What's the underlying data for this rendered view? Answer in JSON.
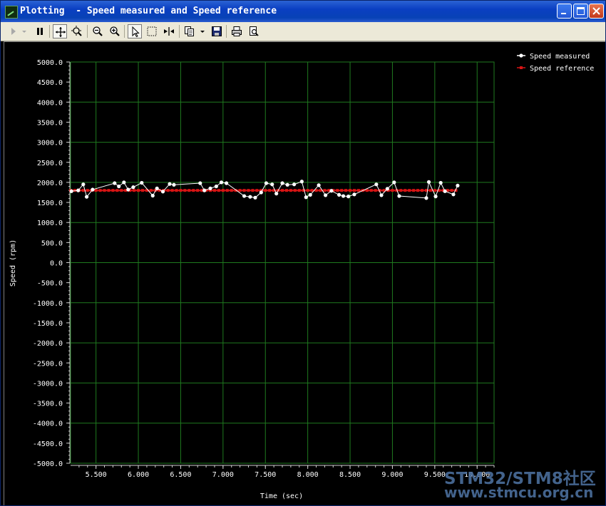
{
  "window": {
    "title": "Plotting  - Speed measured and Speed reference",
    "controls": [
      "minimize-icon",
      "maximize-icon",
      "close-icon"
    ]
  },
  "toolbar": {
    "tools": [
      "play-icon",
      "dropdown-icon",
      "pause-icon",
      "pan-icon",
      "zoom-fit-icon",
      "zoom-out-icon",
      "zoom-in-icon",
      "select-pointer-icon",
      "select-rect-icon",
      "split-cursor-icon",
      "copy-icon",
      "dropdown-icon",
      "save-icon",
      "print-icon",
      "print-preview-icon"
    ]
  },
  "watermark": {
    "line1": "STM32/STM8社区",
    "line2": "www.stmcu.org.cn"
  },
  "colors": {
    "background": "#000000",
    "grid": "#1f7a1f",
    "axis": "#cfcfcf",
    "measured": "#ffffff",
    "reference": "#d81414"
  },
  "chart_data": {
    "type": "line",
    "title": "",
    "xlabel": "Time (sec)",
    "ylabel": "Speed (rpm)",
    "xlim": [
      5.2,
      10.2
    ],
    "ylim": [
      -5000,
      5000
    ],
    "grid": true,
    "legend": "top-right",
    "xticks": [
      5.5,
      6.0,
      6.5,
      7.0,
      7.5,
      8.0,
      8.5,
      9.0,
      9.5,
      10.0
    ],
    "xtick_labels": [
      "5.500",
      "6.000",
      "6.500",
      "7.000",
      "7.500",
      "8.000",
      "8.500",
      "9.000",
      "9.500",
      "10.000"
    ],
    "yticks": [
      5000,
      4500,
      4000,
      3500,
      3000,
      2500,
      2000,
      1500,
      1000,
      500,
      0,
      -500,
      -1000,
      -1500,
      -2000,
      -2500,
      -3000,
      -3500,
      -4000,
      -4500,
      -5000
    ],
    "ytick_labels": [
      "5000.0",
      "4500.0",
      "4000.0",
      "3500.0",
      "3000.0",
      "2500.0",
      "2000.0",
      "1500.0",
      "1000.0",
      "500.0",
      "0.0",
      "-500.0",
      "-1000.0",
      "-1500.0",
      "-2000.0",
      "-2500.0",
      "-3000.0",
      "-3500.0",
      "-4000.0",
      "-4500.0",
      "-5000.0"
    ],
    "series": [
      {
        "name": "Speed measured",
        "color": "#ffffff",
        "marker": "circle",
        "x": [
          5.21,
          5.29,
          5.35,
          5.39,
          5.46,
          5.72,
          5.77,
          5.83,
          5.88,
          5.94,
          6.04,
          6.17,
          6.22,
          6.29,
          6.37,
          6.42,
          6.73,
          6.78,
          6.85,
          6.92,
          6.98,
          7.04,
          7.25,
          7.32,
          7.38,
          7.45,
          7.51,
          7.58,
          7.63,
          7.7,
          7.76,
          7.84,
          7.93,
          7.98,
          8.03,
          8.13,
          8.21,
          8.28,
          8.37,
          8.42,
          8.48,
          8.55,
          8.81,
          8.87,
          8.94,
          9.02,
          9.08,
          9.4,
          9.43,
          9.51,
          9.57,
          9.62,
          9.72,
          9.77
        ],
        "y": [
          1780,
          1800,
          1950,
          1640,
          1820,
          1980,
          1900,
          2000,
          1820,
          1880,
          1990,
          1670,
          1850,
          1770,
          1960,
          1940,
          1980,
          1800,
          1850,
          1900,
          2000,
          1980,
          1660,
          1640,
          1620,
          1750,
          1980,
          1950,
          1720,
          1980,
          1940,
          1950,
          2020,
          1630,
          1690,
          1930,
          1680,
          1790,
          1690,
          1660,
          1650,
          1700,
          1950,
          1680,
          1840,
          2000,
          1660,
          1610,
          2010,
          1650,
          1990,
          1780,
          1700,
          1920
        ]
      },
      {
        "name": "Speed reference",
        "color": "#d81414",
        "marker": "square",
        "x": [
          5.2,
          5.25,
          5.3,
          5.35,
          5.4,
          5.45,
          5.5,
          5.55,
          5.6,
          5.65,
          5.7,
          5.75,
          5.8,
          5.85,
          5.9,
          5.95,
          6.0,
          6.05,
          6.1,
          6.15,
          6.2,
          6.25,
          6.3,
          6.35,
          6.4,
          6.45,
          6.5,
          6.55,
          6.6,
          6.65,
          6.7,
          6.75,
          6.8,
          6.85,
          6.9,
          6.95,
          7.0,
          7.05,
          7.1,
          7.15,
          7.2,
          7.25,
          7.3,
          7.35,
          7.4,
          7.45,
          7.5,
          7.55,
          7.6,
          7.65,
          7.7,
          7.75,
          7.8,
          7.85,
          7.9,
          7.95,
          8.0,
          8.05,
          8.1,
          8.15,
          8.2,
          8.25,
          8.3,
          8.35,
          8.4,
          8.45,
          8.5,
          8.55,
          8.6,
          8.65,
          8.7,
          8.75,
          8.8,
          8.85,
          8.9,
          8.95,
          9.0,
          9.05,
          9.1,
          9.15,
          9.2,
          9.25,
          9.3,
          9.35,
          9.4,
          9.45,
          9.5,
          9.55,
          9.6,
          9.65,
          9.7,
          9.75
        ],
        "y": [
          1800,
          1800,
          1800,
          1800,
          1800,
          1800,
          1800,
          1800,
          1800,
          1800,
          1800,
          1800,
          1800,
          1800,
          1800,
          1800,
          1800,
          1800,
          1800,
          1800,
          1800,
          1800,
          1800,
          1800,
          1800,
          1800,
          1800,
          1800,
          1800,
          1800,
          1800,
          1800,
          1800,
          1800,
          1800,
          1800,
          1800,
          1800,
          1800,
          1800,
          1800,
          1800,
          1800,
          1800,
          1800,
          1800,
          1800,
          1800,
          1800,
          1800,
          1800,
          1800,
          1800,
          1800,
          1800,
          1800,
          1800,
          1800,
          1800,
          1800,
          1800,
          1800,
          1800,
          1800,
          1800,
          1800,
          1800,
          1800,
          1800,
          1800,
          1800,
          1800,
          1800,
          1800,
          1800,
          1800,
          1800,
          1800,
          1800,
          1800,
          1800,
          1800,
          1800,
          1800,
          1800,
          1800,
          1800,
          1800,
          1800,
          1800,
          1800,
          1800
        ]
      }
    ]
  }
}
